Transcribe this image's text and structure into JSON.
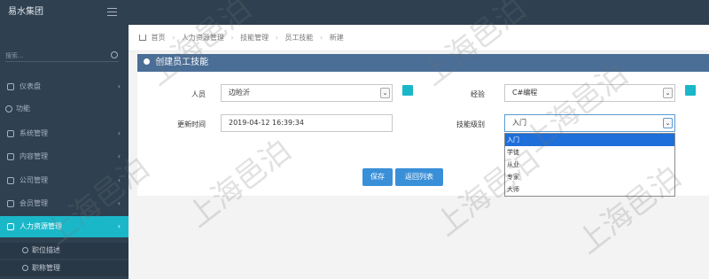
{
  "app": {
    "brand": "易水集团"
  },
  "sidebar": {
    "search_placeholder": "搜索...",
    "items": [
      {
        "label": "仪表盘",
        "has_children": true
      },
      {
        "label": "功能",
        "has_children": false
      },
      {
        "label": "系统管理",
        "has_children": true
      },
      {
        "label": "内容管理",
        "has_children": true
      },
      {
        "label": "公司管理",
        "has_children": true
      },
      {
        "label": "会员管理",
        "has_children": true
      },
      {
        "label": "人力资源管理",
        "has_children": true,
        "active": true
      }
    ],
    "sub_items": [
      {
        "label": "职位描述"
      },
      {
        "label": "职称管理"
      }
    ],
    "chevron": "‹"
  },
  "breadcrumb": {
    "items": [
      "首页",
      "人力资源管理",
      "技能管理",
      "员工技能",
      "新建"
    ],
    "separator": "›"
  },
  "panel": {
    "title": "创建员工技能"
  },
  "form": {
    "person_label": "人员",
    "person_value": "边睑沂",
    "experience_label": "经验",
    "experience_value": "C#编程",
    "update_time_label": "更新时间",
    "update_time_value": "2019-04-12 16:39:34",
    "skill_level_label": "技能级别",
    "skill_level_value": "入门",
    "dropdown_arrow": "⌄"
  },
  "skill_level_options": [
    "入门",
    "学徒",
    "从业",
    "专家",
    "大师"
  ],
  "buttons": {
    "save": "保存",
    "back": "返回列表"
  },
  "watermark": {
    "text": "上海邑泊"
  },
  "colors": {
    "sidebar_bg": "#2f4050",
    "active": "#1ab7c9",
    "panel_head": "#4a6e96",
    "primary_btn": "#3a8fd9"
  }
}
